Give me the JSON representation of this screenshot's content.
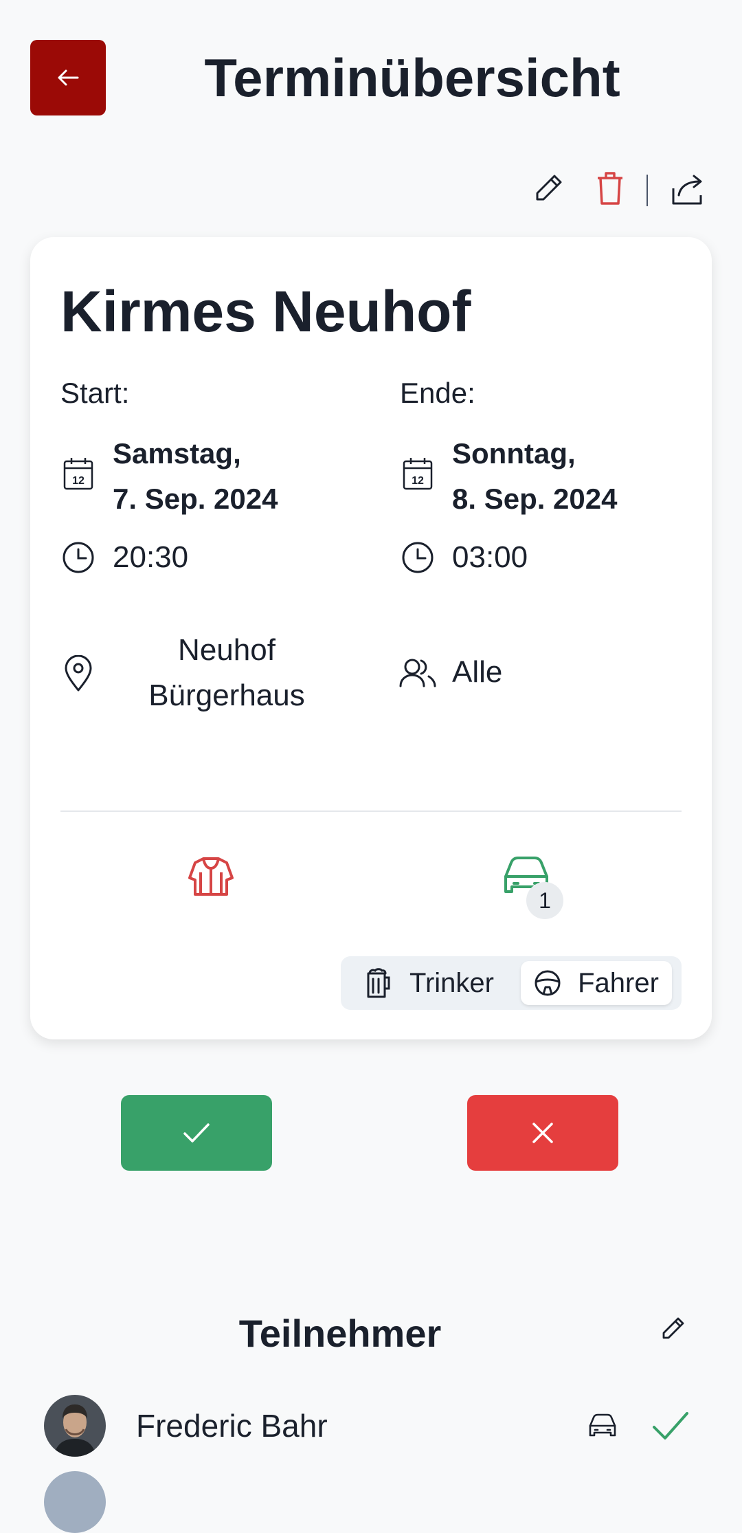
{
  "header": {
    "title": "Terminübersicht",
    "back_icon": "arrow-left-icon"
  },
  "toolbar": {
    "edit_icon": "pencil-icon",
    "delete_icon": "trash-icon",
    "share_icon": "share-icon"
  },
  "event": {
    "title": "Kirmes Neuhof",
    "start": {
      "label": "Start:",
      "date_line1": "Samstag,",
      "date_line2": "7. Sep. 2024",
      "time": "20:30"
    },
    "end": {
      "label": "Ende:",
      "date_line1": "Sonntag,",
      "date_line2": "8. Sep. 2024",
      "time": "03:00"
    },
    "location_line1": "Neuhof",
    "location_line2": "Bürgerhaus",
    "group": "Alle",
    "calendar_icon_day": "12",
    "driver_count": "1"
  },
  "segment": {
    "option1": "Trinker",
    "option2": "Fahrer",
    "selected": "Fahrer"
  },
  "actions": {
    "accept_icon": "check-icon",
    "decline_icon": "x-icon"
  },
  "participants": {
    "title": "Teilnehmer",
    "items": [
      {
        "name": "Frederic Bahr",
        "role_icon": "car-icon",
        "status_icon": "check-icon"
      }
    ]
  },
  "colors": {
    "brand_red": "#9b0a06",
    "accent_red": "#d64545",
    "accept_green": "#38a169",
    "decline_red": "#e53e3e",
    "text": "#1a202c"
  }
}
